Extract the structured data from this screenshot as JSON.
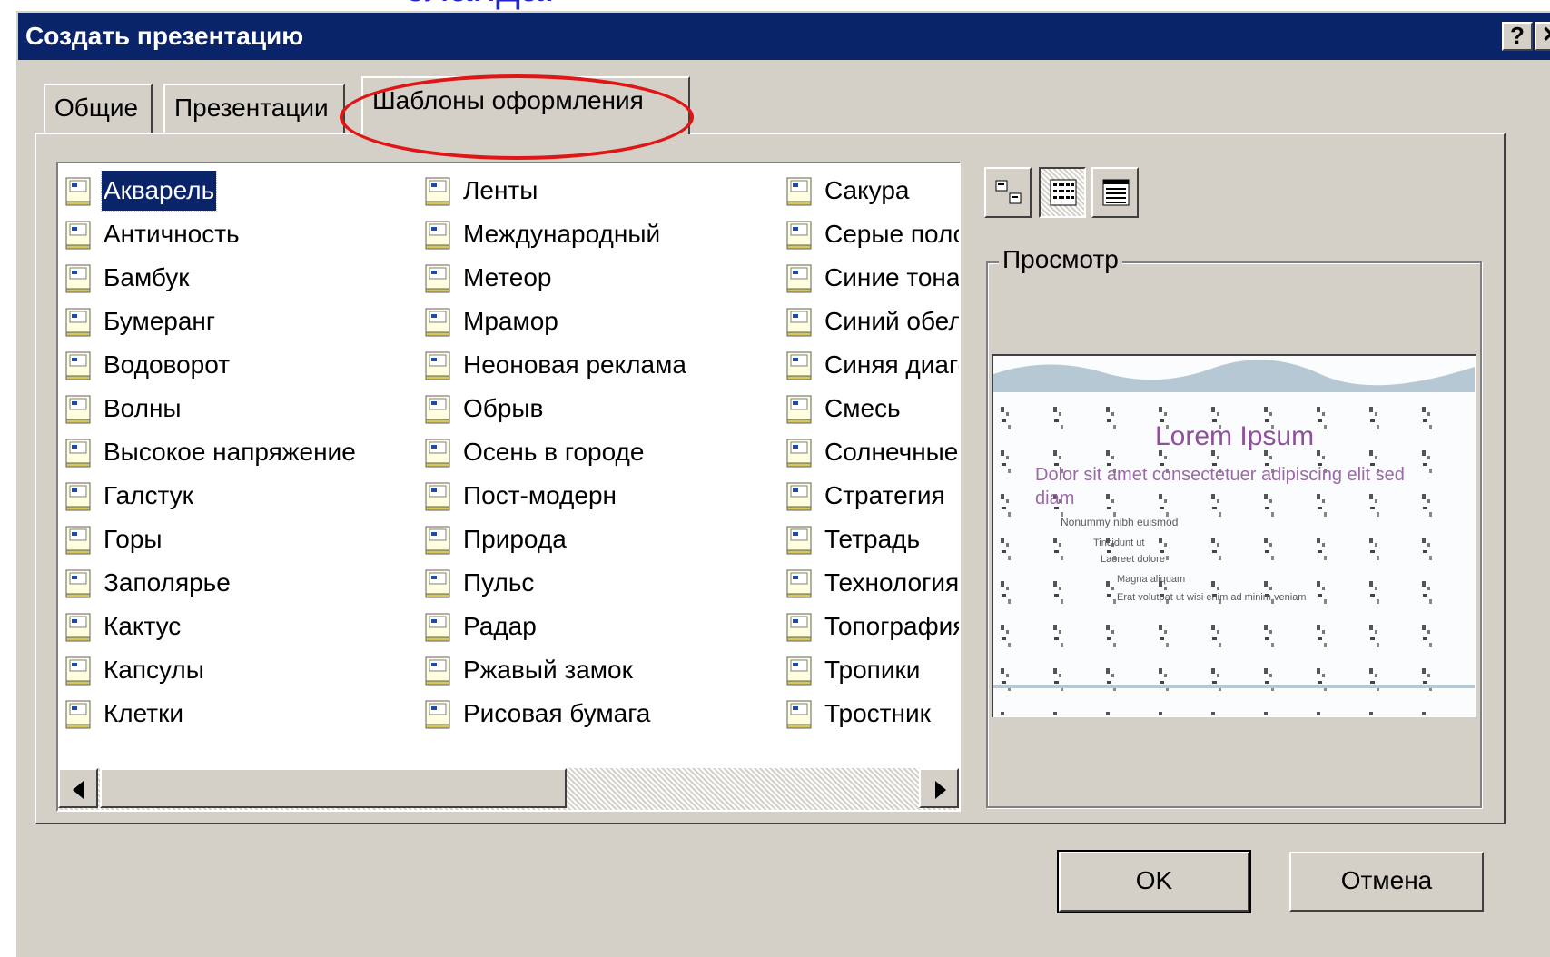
{
  "slide_caption": "слайда.",
  "dialog": {
    "title": "Создать презентацию",
    "help_label": "?",
    "close_label": "✕"
  },
  "tabs": [
    {
      "label": "Общие"
    },
    {
      "label": "Презентации"
    },
    {
      "label": "Шаблоны оформления",
      "active": true
    }
  ],
  "templates": {
    "columns": [
      [
        "Акварель",
        "Античность",
        "Бамбук",
        "Бумеранг",
        "Водоворот",
        "Волны",
        "Высокое напряжение",
        "Галстук",
        "Горы",
        "Заполярье",
        "Кактус",
        "Капсулы",
        "Клетки"
      ],
      [
        "Ленты",
        "Международный",
        "Метеор",
        "Мрамор",
        "Неоновая реклама",
        "Обрыв",
        "Осень в городе",
        "Пост-модерн",
        "Природа",
        "Пульс",
        "Радар",
        "Ржавый замок",
        "Рисовая бумага"
      ],
      [
        "Сакура",
        "Серые полосы",
        "Синие тона",
        "Синий обелиск",
        "Синяя диагональ",
        "Смесь",
        "Солнечные лучи",
        "Стратегия",
        "Тетрадь",
        "Технология",
        "Топография",
        "Тропики",
        "Тростник"
      ]
    ],
    "selected": "Акварель"
  },
  "preview": {
    "label": "Просмотр",
    "slide_title": "Lorem Ipsum",
    "bullet1": "Dolor sit amet consectetuer adipiscing elit sed diam",
    "bullet2": "Nonummy nibh euismod",
    "bullet3": "Tincidunt ut",
    "bullet4": "Laoreet dolore",
    "bullet5": "Magna aliquam",
    "bullet6": "Erat volutpat ut wisi enim ad minim veniam"
  },
  "buttons": {
    "ok": "OK",
    "cancel": "Отмена"
  },
  "colors": {
    "titlebar": "#0a246a",
    "face": "#d4d0c8",
    "highlight_ellipse": "#e01515",
    "caption": "#2323c8"
  }
}
